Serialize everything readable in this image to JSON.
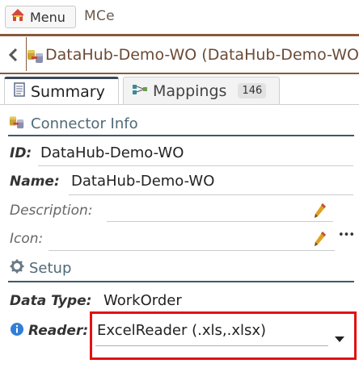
{
  "topbar": {
    "menu_label": "Menu",
    "app_title": "MCe"
  },
  "breadcrumb": {
    "title": "DataHub-Demo-WO (DataHub-Demo-WO)"
  },
  "tabs": [
    {
      "label": "Summary",
      "active": true
    },
    {
      "label": "Mappings",
      "count": "146",
      "active": false
    }
  ],
  "connector_info": {
    "heading": "Connector Info",
    "id_label": "ID:",
    "id_value": "DataHub-Demo-WO",
    "name_label": "Name:",
    "name_value": "DataHub-Demo-WO",
    "description_label": "Description:",
    "icon_label": "Icon:",
    "icon_menu": "•••"
  },
  "setup": {
    "heading": "Setup",
    "datatype_label": "Data Type:",
    "datatype_value": "WorkOrder",
    "reader_label": "Reader:",
    "reader_value": "ExcelReader (.xls,.xlsx)"
  },
  "colors": {
    "accent_brown": "#8a5a3a",
    "section_teal": "#4f6a78",
    "highlight_red": "#e01212",
    "pencil_yellow": "#e0a020"
  }
}
